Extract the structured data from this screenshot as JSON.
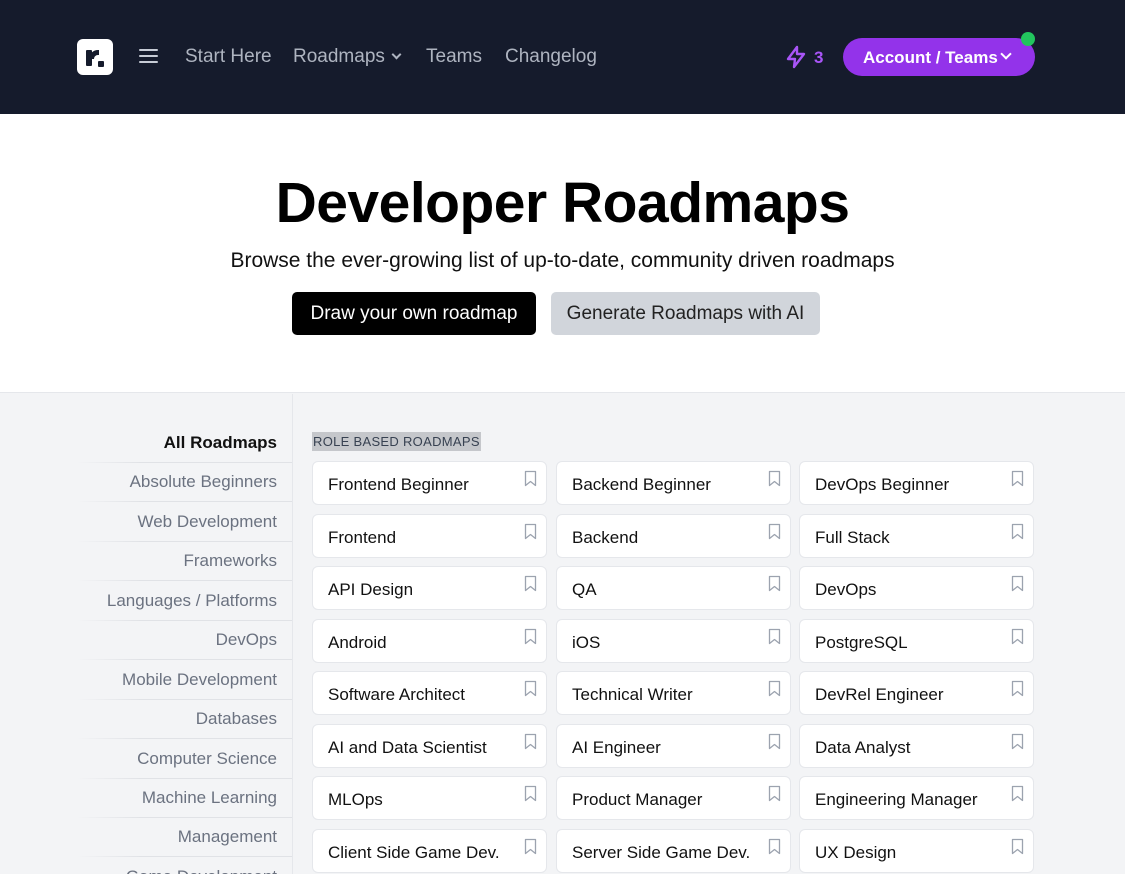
{
  "header": {
    "nav": [
      {
        "label": "Start Here"
      },
      {
        "label": "Roadmaps"
      },
      {
        "label": "Teams"
      },
      {
        "label": "Changelog"
      }
    ],
    "streak_count": "3",
    "account_label": "Account / Teams",
    "colors": {
      "background": "#151b2c",
      "accent": "#9333ea",
      "streak": "#a855f7",
      "online": "#22c55e"
    }
  },
  "hero": {
    "title": "Developer Roadmaps",
    "subtitle": "Browse the ever-growing list of up-to-date, community driven roadmaps",
    "draw_button": "Draw your own roadmap",
    "ai_button": "Generate Roadmaps with AI"
  },
  "sidebar": {
    "items": [
      {
        "label": "All Roadmaps"
      },
      {
        "label": "Absolute Beginners"
      },
      {
        "label": "Web Development"
      },
      {
        "label": "Frameworks"
      },
      {
        "label": "Languages / Platforms"
      },
      {
        "label": "DevOps"
      },
      {
        "label": "Mobile Development"
      },
      {
        "label": "Databases"
      },
      {
        "label": "Computer Science"
      },
      {
        "label": "Machine Learning"
      },
      {
        "label": "Management"
      },
      {
        "label": "Game Development"
      }
    ]
  },
  "main": {
    "section_label": "ROLE BASED ROADMAPS",
    "roadmaps": [
      {
        "name": "Frontend Beginner"
      },
      {
        "name": "Backend Beginner"
      },
      {
        "name": "DevOps Beginner"
      },
      {
        "name": "Frontend"
      },
      {
        "name": "Backend"
      },
      {
        "name": "Full Stack"
      },
      {
        "name": "API Design"
      },
      {
        "name": "QA"
      },
      {
        "name": "DevOps"
      },
      {
        "name": "Android"
      },
      {
        "name": "iOS"
      },
      {
        "name": "PostgreSQL"
      },
      {
        "name": "Software Architect"
      },
      {
        "name": "Technical Writer"
      },
      {
        "name": "DevRel Engineer"
      },
      {
        "name": "AI and Data Scientist"
      },
      {
        "name": "AI Engineer"
      },
      {
        "name": "Data Analyst"
      },
      {
        "name": "MLOps"
      },
      {
        "name": "Product Manager"
      },
      {
        "name": "Engineering Manager"
      },
      {
        "name": "Client Side Game Dev."
      },
      {
        "name": "Server Side Game Dev."
      },
      {
        "name": "UX Design"
      }
    ]
  }
}
